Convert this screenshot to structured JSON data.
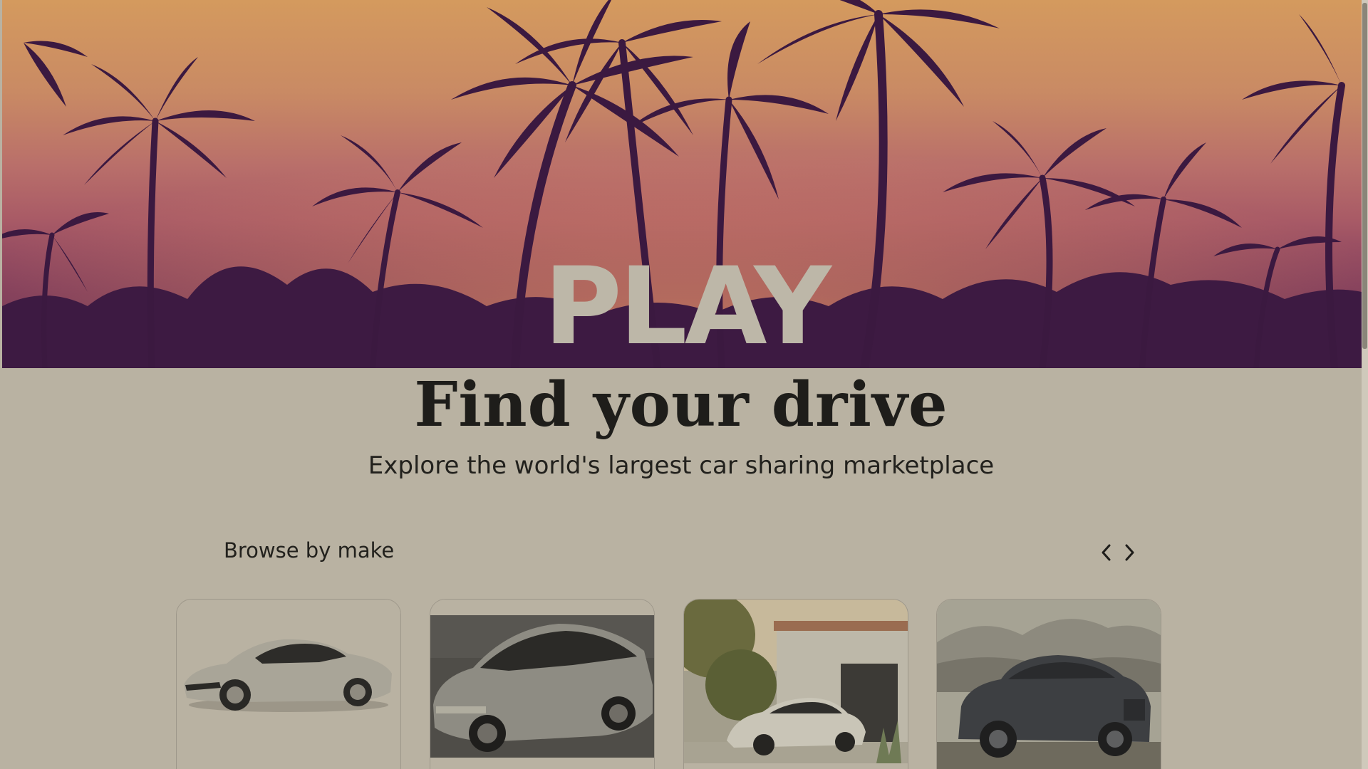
{
  "hero": {
    "logo_text": "PLAY"
  },
  "headline": "Find your drive",
  "subhead": "Explore the world's largest car sharing marketplace",
  "browse": {
    "title": "Browse by make",
    "prev_label": "‹",
    "next_label": "›",
    "cards": [
      {
        "name": "silver-sedan"
      },
      {
        "name": "gray-sedan"
      },
      {
        "name": "white-suv-house"
      },
      {
        "name": "dark-suv-mountains"
      }
    ]
  }
}
